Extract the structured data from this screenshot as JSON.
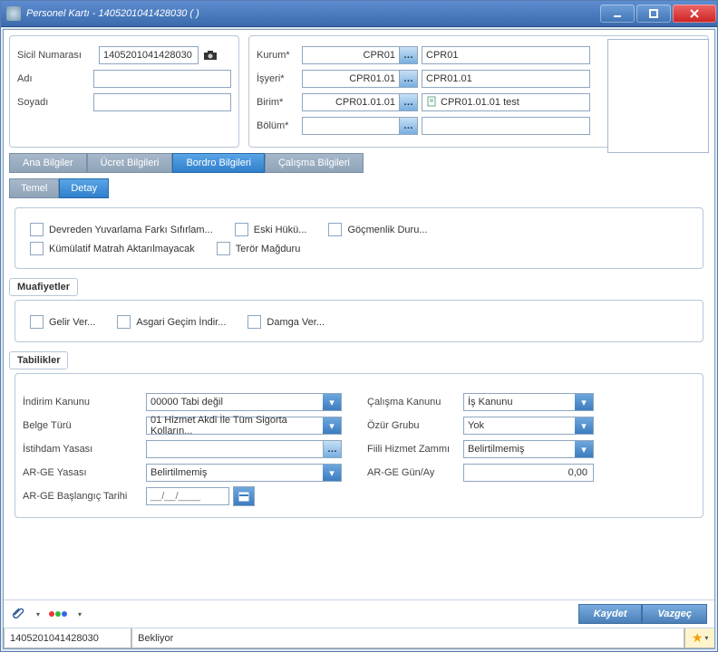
{
  "window": {
    "title": "Personel Kartı - 1405201041428030 ( )"
  },
  "ident": {
    "sicil_label": "Sicil Numarası",
    "sicil_value": "1405201041428030",
    "adi_label": "Adı",
    "adi_value": "",
    "soyadi_label": "Soyadı",
    "soyadi_value": ""
  },
  "org": {
    "kurum_label": "Kurum*",
    "kurum_code": "CPR01",
    "kurum_name": "CPR01",
    "isyeri_label": "İşyeri*",
    "isyeri_code": "CPR01.01",
    "isyeri_name": "CPR01.01",
    "birim_label": "Birim*",
    "birim_code": "CPR01.01.01",
    "birim_name": "CPR01.01.01 test",
    "bolum_label": "Bölüm*",
    "bolum_code": "",
    "bolum_name": ""
  },
  "tabs": {
    "ana": "Ana Bilgiler",
    "ucret": "Ücret Bilgileri",
    "bordro": "Bordro Bilgileri",
    "calisma": "Çalışma Bilgileri"
  },
  "subtabs": {
    "temel": "Temel",
    "detay": "Detay"
  },
  "checks": {
    "devreden": "Devreden Yuvarlama Farkı Sıfırlam...",
    "eskihukum": "Eski Hükü...",
    "gocmenlik": "Göçmenlik Duru...",
    "kumulatif": "Kümülatif Matrah Aktarılmayacak",
    "teror": "Terör Mağduru"
  },
  "labels": {
    "muafiyetler": "Muafiyetler",
    "tabilikler": "Tabilikler"
  },
  "exempt": {
    "gelir": "Gelir Ver...",
    "asgari": "Asgari Geçim İndir...",
    "damga": "Damga Ver..."
  },
  "form": {
    "indirim_label": "İndirim Kanunu",
    "indirim_value": "00000 Tabi değil",
    "belge_label": "Belge Türü",
    "belge_value": "01 Hizmet Akdi İle Tüm Sigorta Kolların...",
    "istihdam_label": "İstihdam Yasası",
    "istihdam_value": "",
    "arge_yasasi_label": "AR-GE Yasası",
    "arge_yasasi_value": "Belirtilmemiş",
    "arge_tarih_label": "AR-GE Başlangıç Tarihi",
    "arge_tarih_value": "__/__/____",
    "calisma_label": "Çalışma Kanunu",
    "calisma_value": "İş Kanunu",
    "ozur_label": "Özür Grubu",
    "ozur_value": "Yok",
    "fiili_label": "Fiili Hizmet Zammı",
    "fiili_value": "Belirtilmemiş",
    "arge_gun_label": "AR-GE Gün/Ay",
    "arge_gun_value": "0,00"
  },
  "buttons": {
    "kaydet": "Kaydet",
    "vazgec": "Vazgeç"
  },
  "status": {
    "id": "1405201041428030",
    "state": "Bekliyor"
  }
}
